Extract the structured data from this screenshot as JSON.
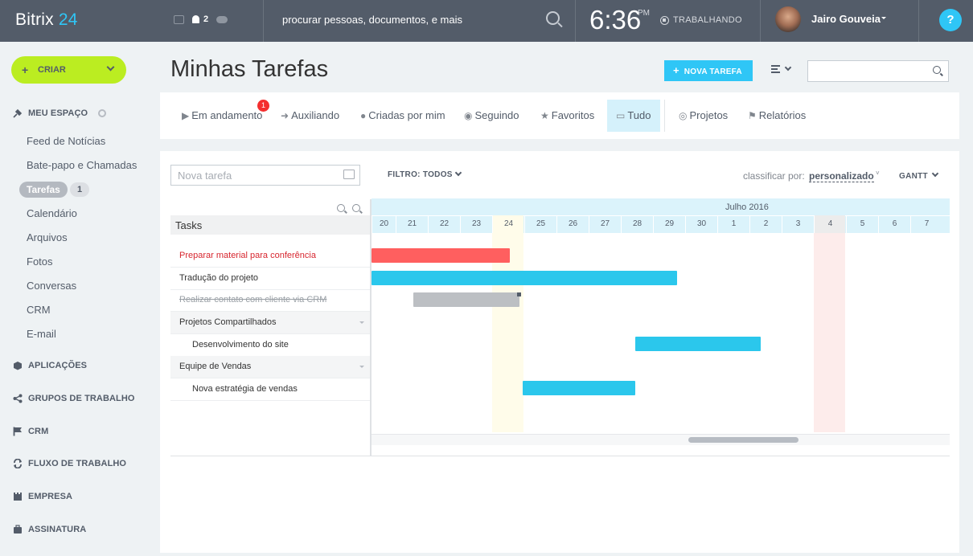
{
  "topbar": {
    "logo_prefix": "Bitrix",
    "logo_num": "24",
    "notifications": "2",
    "search_placeholder": "procurar pessoas, documentos, e mais",
    "time": "6:36",
    "ampm": "PM",
    "work_status": "TRABALHANDO",
    "user_name": "Jairo Gouveia",
    "help": "?"
  },
  "sidebar": {
    "create_label": "CRIAR",
    "my_space": "MEU ESPAÇO",
    "items": [
      "Feed de Notícias",
      "Bate-papo e Chamadas",
      "Tarefas",
      "Calendário",
      "Arquivos",
      "Fotos",
      "Conversas",
      "CRM",
      "E-mail"
    ],
    "tasks_count": "1",
    "sections": [
      "APLICAÇÕES",
      "GRUPOS DE TRABALHO",
      "CRM",
      "FLUXO DE TRABALHO",
      "EMPRESA",
      "ASSINATURA"
    ]
  },
  "header": {
    "title": "Minhas Tarefas",
    "new_task": "NOVA TAREFA"
  },
  "tabs": [
    {
      "label": "Em andamento",
      "icon": "play-icon"
    },
    {
      "label": "Auxiliando",
      "icon": "arrow-icon"
    },
    {
      "label": "Criadas por mim",
      "icon": "user-icon"
    },
    {
      "label": "Seguindo",
      "icon": "eye-icon"
    },
    {
      "label": "Favoritos",
      "icon": "star-icon"
    },
    {
      "label": "Tudo",
      "icon": "inbox-icon"
    },
    {
      "label": "Projetos",
      "icon": "compass-icon"
    },
    {
      "label": "Relatórios",
      "icon": "flag-icon"
    }
  ],
  "tab_badge": "1",
  "toolbar": {
    "quick_task_placeholder": "Nova tarefa",
    "filter": "FILTRO: TODOS",
    "sort_label": "classificar por:",
    "sort_value": "personalizado",
    "view": "GANTT"
  },
  "gantt": {
    "tree_title": "Tasks",
    "month": "Julho 2016",
    "days": [
      "20",
      "21",
      "22",
      "23",
      "24",
      "25",
      "26",
      "27",
      "28",
      "29",
      "30",
      "1",
      "2",
      "3",
      "4",
      "5",
      "6",
      "7"
    ],
    "rows": [
      {
        "label": "Preparar material para conferência",
        "type": "task",
        "style": "overdue"
      },
      {
        "label": "Tradução do projeto",
        "type": "task",
        "style": "normal"
      },
      {
        "label": "Realizar contato com cliente via CRM",
        "type": "task",
        "style": "done"
      },
      {
        "label": "Projetos Compartilhados",
        "type": "group",
        "style": "normal"
      },
      {
        "label": "Desenvolvimento do site",
        "type": "sub",
        "style": "normal"
      },
      {
        "label": "Equipe de Vendas",
        "type": "group",
        "style": "normal"
      },
      {
        "label": "Nova estratégia de vendas",
        "type": "sub",
        "style": "normal"
      }
    ],
    "bars": [
      {
        "row": 0,
        "start": 20,
        "end": 24.3,
        "color": "#ff5f5f"
      },
      {
        "row": 1,
        "start": 20,
        "end": 29.5,
        "color": "#2bc7ec"
      },
      {
        "row": 2,
        "start": 21.3,
        "end": 24.6,
        "color": "#bcbfc3"
      },
      {
        "row": 4,
        "start": 28.2,
        "end": 32.1,
        "color": "#2bc7ec"
      },
      {
        "row": 6,
        "start": 24.7,
        "end": 28.2,
        "color": "#2bc7ec"
      }
    ]
  }
}
